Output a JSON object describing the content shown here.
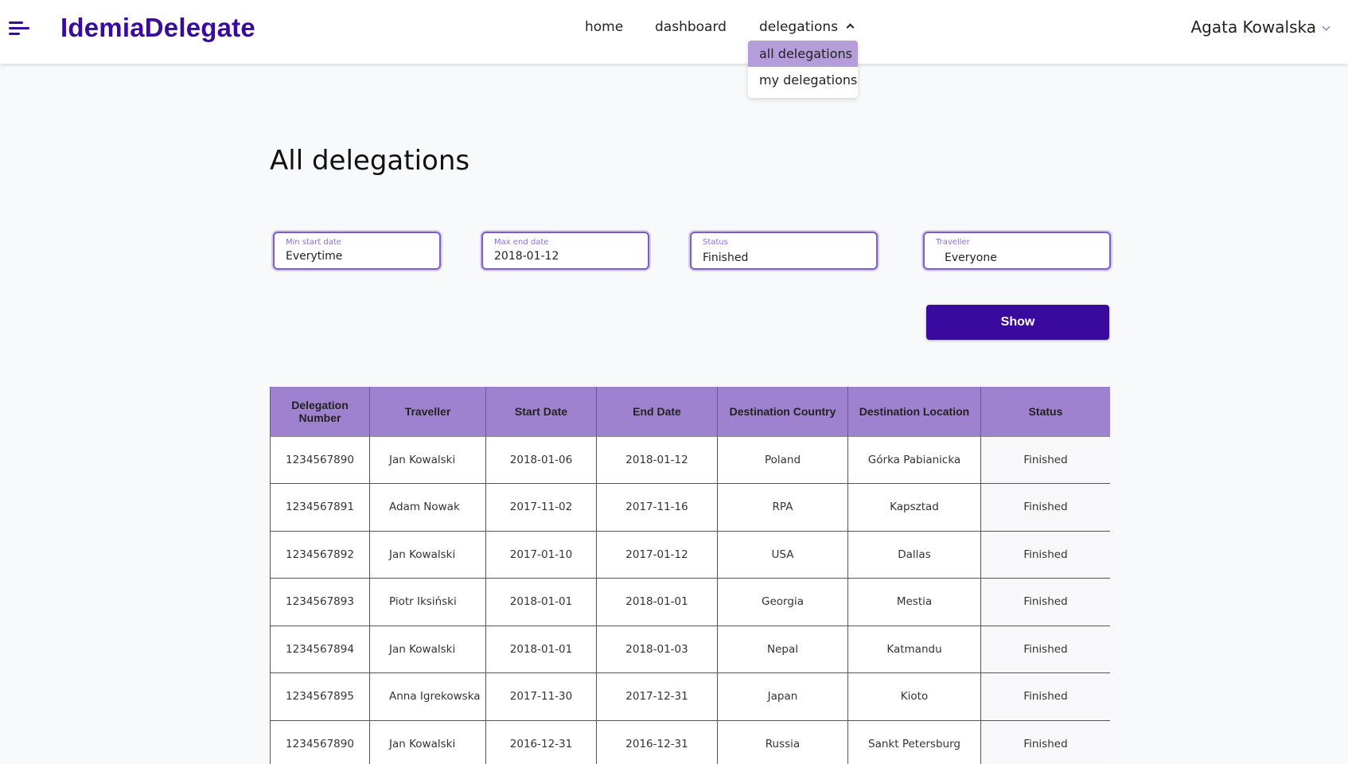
{
  "header": {
    "logo": "IdemiaDelegate",
    "nav": {
      "home": "home",
      "dashboard": "dashboard",
      "delegations": "delegations"
    },
    "user_name": "Agata Kowalska"
  },
  "dropdown": {
    "items": [
      {
        "label": "all delegations",
        "active": true
      },
      {
        "label": "my delegations",
        "active": false
      }
    ]
  },
  "page": {
    "title": "All delegations"
  },
  "filters": {
    "min_start_date": {
      "label": "Min start date",
      "value": "Everytime"
    },
    "max_end_date": {
      "label": "Max end date",
      "value": "2018-01-12"
    },
    "status": {
      "label": "Status",
      "value": "Finished"
    },
    "traveller": {
      "label": "Traveller",
      "value": "Everyone"
    },
    "show_label": "Show"
  },
  "table": {
    "headers": [
      "Delegation Number",
      "Traveller",
      "Start Date",
      "End Date",
      "Destination Country",
      "Destination Location",
      "Status"
    ],
    "rows": [
      [
        "1234567890",
        "Jan Kowalski",
        "2018-01-06",
        "2018-01-12",
        "Poland",
        "Górka Pabianicka",
        "Finished"
      ],
      [
        "1234567891",
        "Adam Nowak",
        "2017-11-02",
        "2017-11-16",
        "RPA",
        "Kapsztad",
        "Finished"
      ],
      [
        "1234567892",
        "Jan Kowalski",
        "2017-01-10",
        "2017-01-12",
        "USA",
        "Dallas",
        "Finished"
      ],
      [
        "1234567893",
        "Piotr Iksiński",
        "2018-01-01",
        "2018-01-01",
        "Georgia",
        "Mestia",
        "Finished"
      ],
      [
        "1234567894",
        "Jan Kowalski",
        "2018-01-01",
        "2018-01-03",
        "Nepal",
        "Katmandu",
        "Finished"
      ],
      [
        "1234567895",
        "Anna Igrekowska",
        "2017-11-30",
        "2017-12-31",
        "Japan",
        "Kioto",
        "Finished"
      ],
      [
        "1234567890",
        "Jan Kowalski",
        "2016-12-31",
        "2016-12-31",
        "Russia",
        "Sankt Petersburg",
        "Finished"
      ]
    ]
  },
  "colors": {
    "brand": "#3a0a9e",
    "header_row": "#9f82cf",
    "dropdown_active": "#b59ddc",
    "field_border": "#7e5cc9"
  }
}
